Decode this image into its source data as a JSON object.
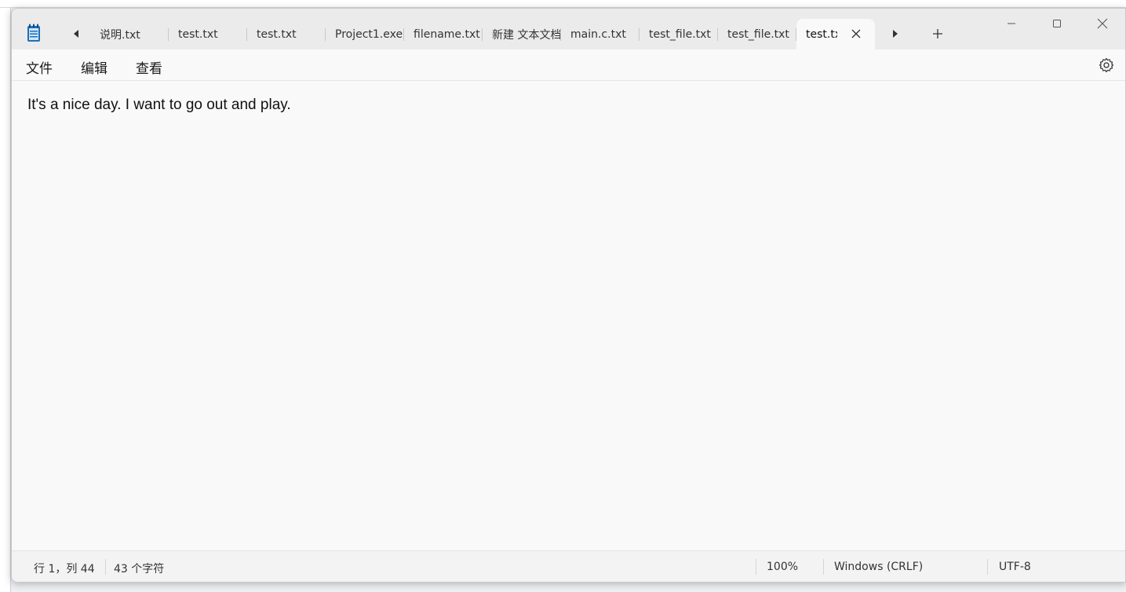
{
  "window": {
    "tabs": [
      {
        "label": "说明.txt"
      },
      {
        "label": "test.txt"
      },
      {
        "label": "test.txt"
      },
      {
        "label": "Project1.exe."
      },
      {
        "label": "filename.txt"
      },
      {
        "label": "新建 文本文档"
      },
      {
        "label": "main.c.txt"
      },
      {
        "label": "test_file.txt"
      },
      {
        "label": "test_file.txt"
      },
      {
        "label": "test.txt",
        "active": true
      }
    ]
  },
  "menu": {
    "file": "文件",
    "edit": "编辑",
    "view": "查看"
  },
  "editor": {
    "content": "It's a nice day. I want to go out and play."
  },
  "statusbar": {
    "position": "行 1，列 44",
    "char_count": "43 个字符",
    "zoom": "100%",
    "line_ending": "Windows (CRLF)",
    "encoding": "UTF-8"
  },
  "colors": {
    "titlebar_bg": "#ebebeb",
    "editor_bg": "#f9f9f9",
    "icon_blue": "#1f6fb5"
  },
  "icons": {
    "app": "notepad-icon",
    "scroll_left": "caret-left-icon",
    "scroll_right": "caret-right-icon",
    "new_tab": "plus-icon",
    "close_tab": "close-icon",
    "minimize": "minimize-icon",
    "maximize": "maximize-icon",
    "close_window": "close-icon",
    "settings": "gear-icon"
  }
}
